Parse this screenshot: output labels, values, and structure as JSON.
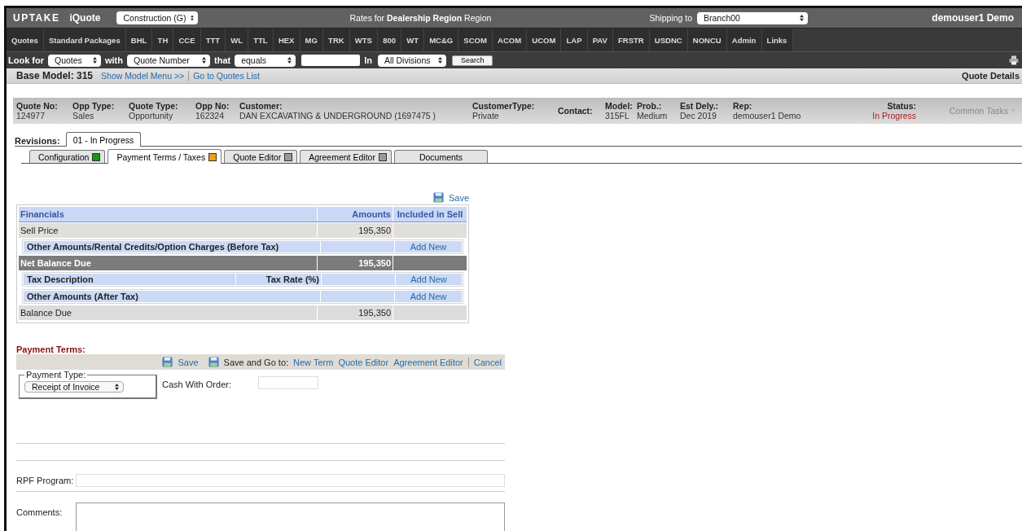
{
  "top_bar": {
    "logo": "UPTAKE",
    "product": "iQuote",
    "segment": "Construction (G)",
    "title": "Rates for **Dealership Region** Region",
    "shipping_label": "Shipping to",
    "shipping_value": "Branch00",
    "user": "demouser1 Demo"
  },
  "nav": [
    "Quotes",
    "Standard Packages",
    "BHL",
    "TH",
    "CCE",
    "TTT",
    "WL",
    "TTL",
    "HEX",
    "MG",
    "TRK",
    "WTS",
    "800",
    "WT",
    "MC&G",
    "SCOM",
    "ACOM",
    "UCOM",
    "LAP",
    "PAV",
    "FRSTR",
    "USDNC",
    "NONCU",
    "Admin",
    "Links"
  ],
  "search_bar": {
    "look_for_label": "Look for",
    "look_for": "Quotes",
    "with_label": "with",
    "with": "Quote Number",
    "that_label": "that",
    "that": "equals",
    "in_label": "In",
    "in": "All Divisions",
    "button": "Search"
  },
  "breadcrumb": {
    "label": "Base Model: 315",
    "links": [
      "Show Model Menu >>",
      "Go to Quotes List"
    ],
    "right": "Quote Details"
  },
  "quote_header": {
    "fields": [
      {
        "label": "Quote No:",
        "value": "124977",
        "kind": "plain"
      },
      {
        "label": "Opp Type:",
        "value": "Sales",
        "kind": "plain"
      },
      {
        "label": "Quote Type:",
        "value": "Opportunity",
        "kind": "plain"
      },
      {
        "label": "Opp No:",
        "value": "162324",
        "kind": "plain"
      },
      {
        "label": "Customer:",
        "value": "DAN EXCAVATING & UNDERGROUND (1697475 )",
        "kind": "plain"
      },
      {
        "label": "CustomerType:",
        "value": "Private",
        "kind": "plain"
      },
      {
        "label": "Contact:",
        "kind": "plain"
      },
      {
        "label": "Model:",
        "value": "315FL",
        "kind": "plain"
      },
      {
        "label": "Prob.:",
        "value": "Medium",
        "kind": "plain"
      },
      {
        "label": "Est Dely.:",
        "value": "Dec 2019",
        "kind": "plain"
      },
      {
        "label": "Rep:",
        "value": "demouser1 Demo",
        "kind": "plain"
      },
      {
        "label": "Status:",
        "value": "In Progress",
        "kind": "status"
      }
    ],
    "menu": "Common Tasks"
  },
  "revisions": {
    "label": "Revisions:",
    "tabs": [
      {
        "label": "01 - In Progress",
        "selected": true
      }
    ]
  },
  "tabs": [
    {
      "label": "Configuration",
      "color": "#139a13",
      "selected": false
    },
    {
      "label": "Payment Terms / Taxes",
      "color": "#f0a010",
      "selected": true
    },
    {
      "label": "Quote Editor",
      "color": "#9a9a9a",
      "selected": false
    },
    {
      "label": "Agreement Editor",
      "color": "#9a9a9a",
      "selected": false
    },
    {
      "label": "Documents",
      "selected": false
    }
  ],
  "financials": {
    "save": "Save",
    "rows": [
      {
        "kind": "header",
        "label": "Financials",
        "amount": "Amounts",
        "included": "Included in Sell"
      },
      {
        "kind": "plain",
        "label": "Sell Price",
        "amount": "195,350"
      },
      {
        "kind": "section",
        "label": "Other Amounts/Rental Credits/Option Charges (Before Tax)",
        "action": "Add New"
      },
      {
        "kind": "total",
        "label": "Net Balance Due",
        "amount": "195,350"
      },
      {
        "kind": "section",
        "label": "Tax Description",
        "label_2": "Tax Rate (%)",
        "action": "Add New"
      },
      {
        "kind": "section",
        "label": "Other Amounts (After Tax)",
        "action": "Add New"
      },
      {
        "kind": "plain",
        "label": "Balance Due",
        "amount": "195,350"
      }
    ]
  },
  "payment_terms": {
    "title": "Payment Terms:",
    "save": "Save",
    "save_go_label": "Save and Go to:",
    "links": [
      "New Term",
      "Quote Editor",
      "Agreement Editor"
    ],
    "cancel": "Cancel",
    "payment_type_legend": "Payment Type:",
    "payment_type": "Receipt of Invoice",
    "cash_label": "Cash With Order:",
    "rpf_label": "RPF Program:",
    "comments_label": "Comments:"
  }
}
